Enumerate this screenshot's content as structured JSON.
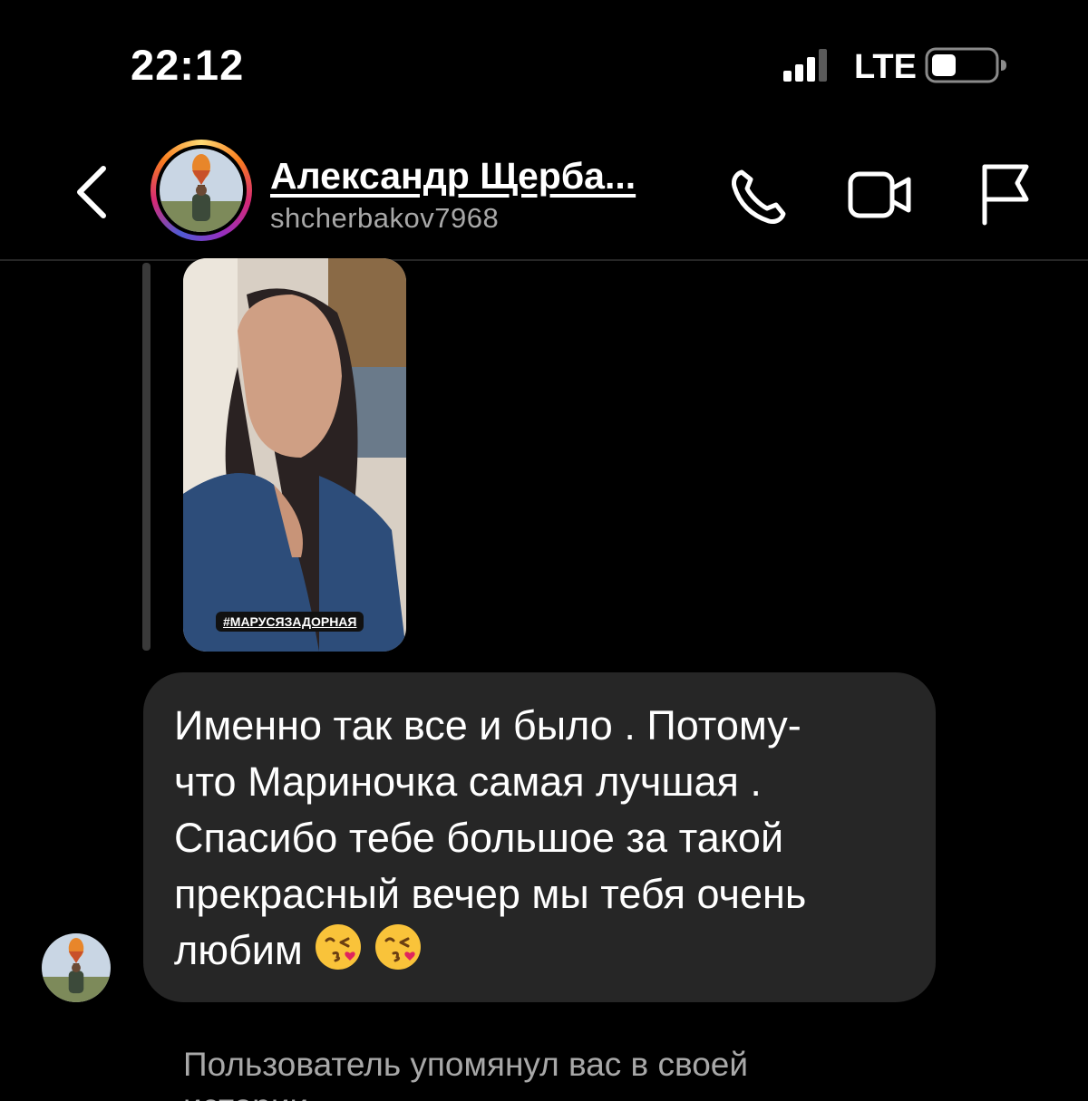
{
  "status_bar": {
    "time": "22:12",
    "network": "LTE",
    "icons": [
      "signal-icon",
      "battery-icon"
    ]
  },
  "header": {
    "contact_name": "Александр Щерба...",
    "username": "shcherbakov7968",
    "icons": [
      "back-chevron-icon",
      "phone-icon",
      "video-camera-icon",
      "flag-icon"
    ]
  },
  "thread": {
    "story_reply": {
      "tag": "#МАРУСЯЗАДОРНАЯ"
    },
    "message": {
      "text": "Именно так все и было . Потому-\nчто Мариночка самая лучшая .\nСпасибо тебе большое за такой\nпрекрасный вечер мы тебя очень\nлюбим",
      "emojis": [
        "kissing-face-with-heart-emoji",
        "kissing-face-with-heart-emoji"
      ]
    },
    "system_note": "Пользователь упомянул вас в своей истории"
  },
  "colors": {
    "background": "#000000",
    "bubble": "#262626",
    "secondary_text": "#a8a8a8",
    "divider": "#262626"
  }
}
